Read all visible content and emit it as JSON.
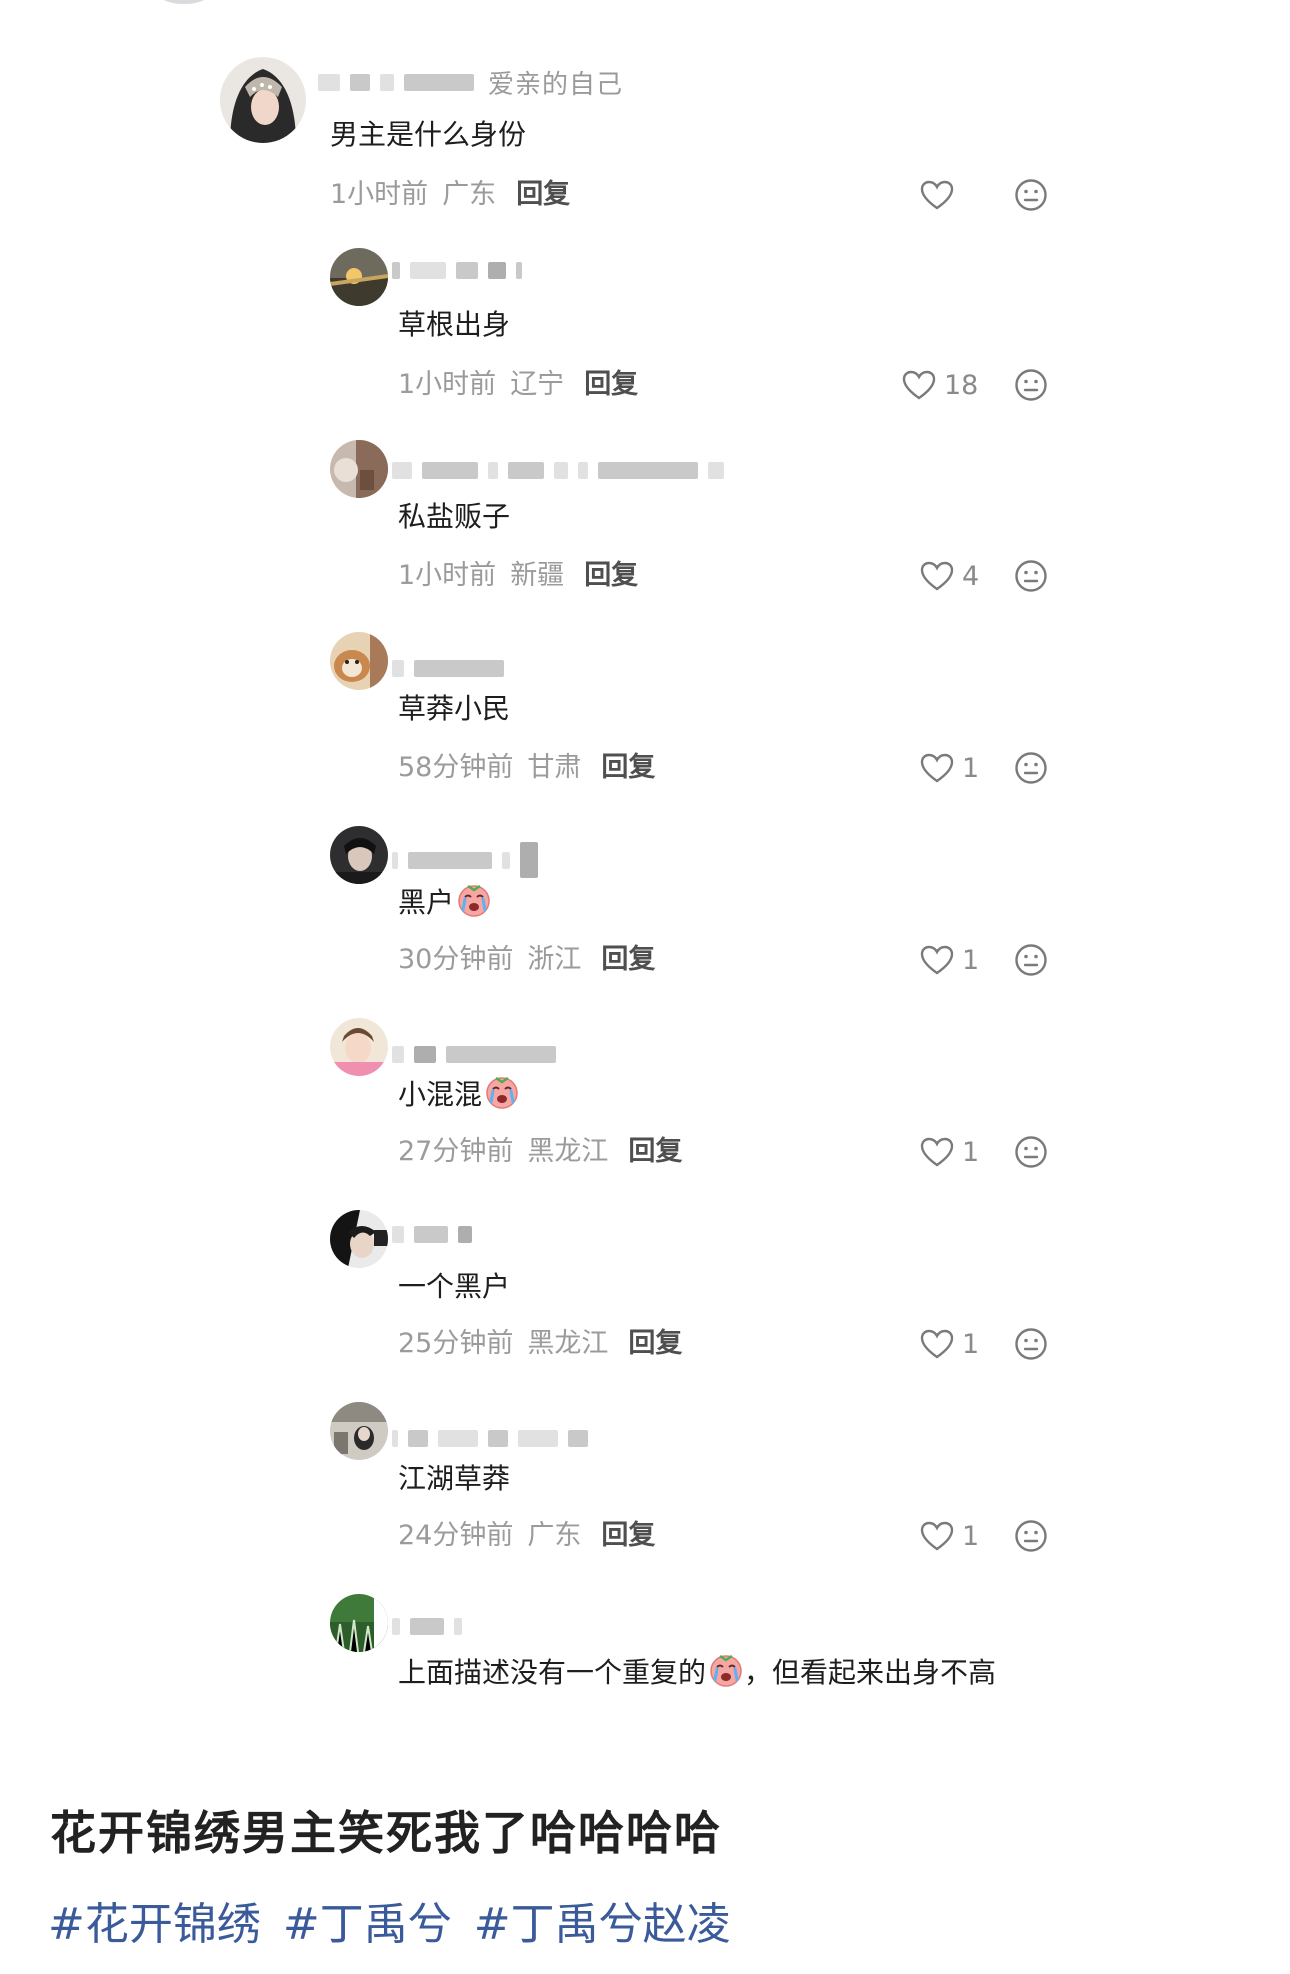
{
  "comments": {
    "main": {
      "username_fragment": "爱亲的自己",
      "text": "男主是什么身份",
      "time": "1小时前",
      "location": "广东",
      "reply_label": "回复",
      "likes": ""
    },
    "replies": [
      {
        "text": "草根出身",
        "time": "1小时前",
        "location": "辽宁",
        "reply_label": "回复",
        "likes": "18"
      },
      {
        "text": "私盐贩子",
        "time": "1小时前",
        "location": "新疆",
        "reply_label": "回复",
        "likes": "4"
      },
      {
        "text": "草莽小民",
        "time": "58分钟前",
        "location": "甘肃",
        "reply_label": "回复",
        "likes": "1"
      },
      {
        "text": "黑户",
        "time": "30分钟前",
        "location": "浙江",
        "reply_label": "回复",
        "likes": "1"
      },
      {
        "text": "小混混",
        "time": "27分钟前",
        "location": "黑龙江",
        "reply_label": "回复",
        "likes": "1"
      },
      {
        "text": "一个黑户",
        "time": "25分钟前",
        "location": "黑龙江",
        "reply_label": "回复",
        "likes": "1"
      },
      {
        "text": "江湖草莽",
        "time": "24分钟前",
        "location": "广东",
        "reply_label": "回复",
        "likes": "1"
      },
      {
        "text_before_emoji": "上面描述没有一个重复的",
        "text_after_emoji": "，但看起来出身不高"
      }
    ]
  },
  "caption": "花开锦绣男主笑死我了哈哈哈哈",
  "hashtags": [
    "#花开锦绣",
    "#丁禹兮",
    "#丁禹兮赵凌"
  ],
  "colors": {
    "meta_gray": "#9b9b9b",
    "hashtag_blue": "#3a5a9a",
    "text": "#1e1e1e"
  },
  "icons": {
    "like": "heart-outline-icon",
    "dislike": "meh-face-icon",
    "emoji": "crying-face-emoji"
  }
}
